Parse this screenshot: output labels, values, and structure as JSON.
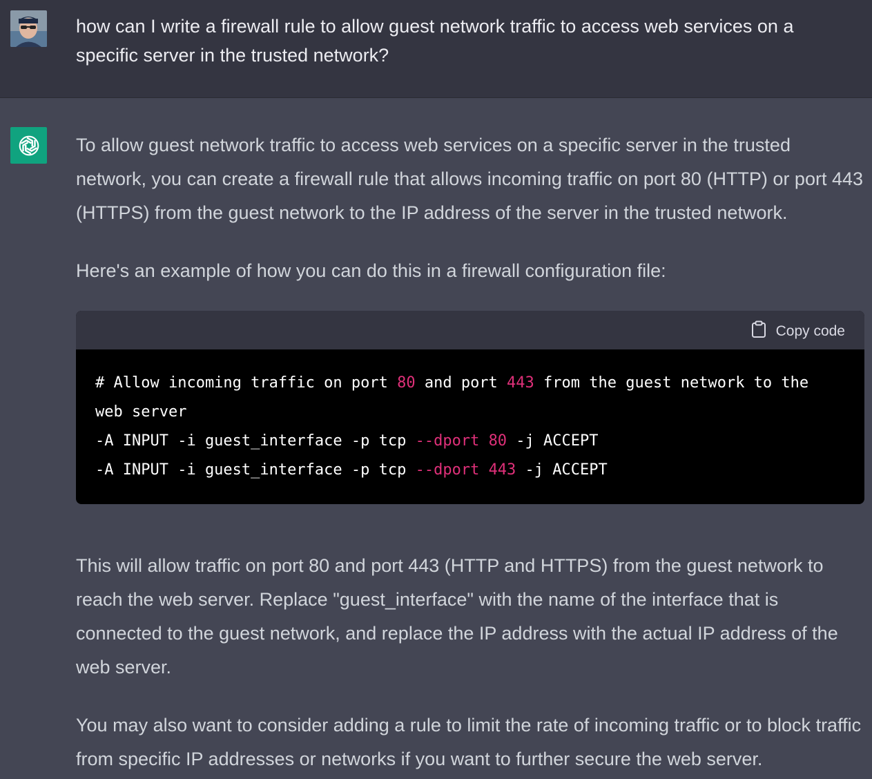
{
  "user_message": {
    "avatar": "user-avatar",
    "text": "how can I write a firewall rule to allow guest network traffic to access web services on a specific server in the trusted network?"
  },
  "assistant_message": {
    "logo": "openai-logo-icon",
    "paragraph_1": "To allow guest network traffic to access web services on a specific server in the trusted network, you can create a firewall rule that allows incoming traffic on port 80 (HTTP) or port 443 (HTTPS) from the guest network to the IP address of the server in the trusted network.",
    "paragraph_2": "Here's an example of how you can do this in a firewall configuration file:",
    "code_block": {
      "copy_label": "Copy code",
      "copy_icon": "clipboard-icon",
      "line1_a": "# Allow incoming traffic on port ",
      "line1_n1": "80",
      "line1_b": " and port ",
      "line1_n2": "443",
      "line1_c": " from the guest network to the web server",
      "line2_a": "-A INPUT -i guest_interface -p tcp ",
      "line2_flag": "--dport",
      "line2_sp": " ",
      "line2_num": "80",
      "line2_b": " -j ACCEPT",
      "line3_a": "-A INPUT -i guest_interface -p tcp ",
      "line3_flag": "--dport",
      "line3_sp": " ",
      "line3_num": "443",
      "line3_b": " -j ACCEPT"
    },
    "paragraph_3": "This will allow traffic on port 80 and port 443 (HTTP and HTTPS) from the guest network to reach the web server. Replace \"guest_interface\" with the name of the interface that is connected to the guest network, and replace the IP address with the actual IP address of the web server.",
    "paragraph_4": "You may also want to consider adding a rule to limit the rate of incoming traffic or to block traffic from specific IP addresses or networks if you want to further secure the web server."
  },
  "colors": {
    "user_bg": "#343541",
    "assistant_bg": "#444654",
    "accent_green": "#10a37f",
    "code_number": "#df3079"
  }
}
